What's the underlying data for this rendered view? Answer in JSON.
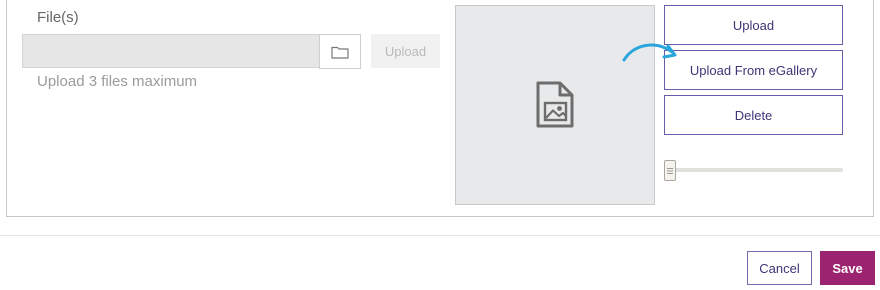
{
  "file_section": {
    "label": "File(s)",
    "path_value": "",
    "browse_icon": "folder-icon",
    "upload_label": "Upload",
    "hint": "Upload 3 files maximum"
  },
  "preview": {
    "icon": "image-file-icon"
  },
  "actions": {
    "upload_label": "Upload",
    "egallery_label": "Upload From eGallery",
    "delete_label": "Delete",
    "arrow_color": "#2aa6dc"
  },
  "zoom_slider": {
    "value": 0
  },
  "footer": {
    "cancel_label": "Cancel",
    "save_label": "Save",
    "save_color": "#9b2370"
  }
}
